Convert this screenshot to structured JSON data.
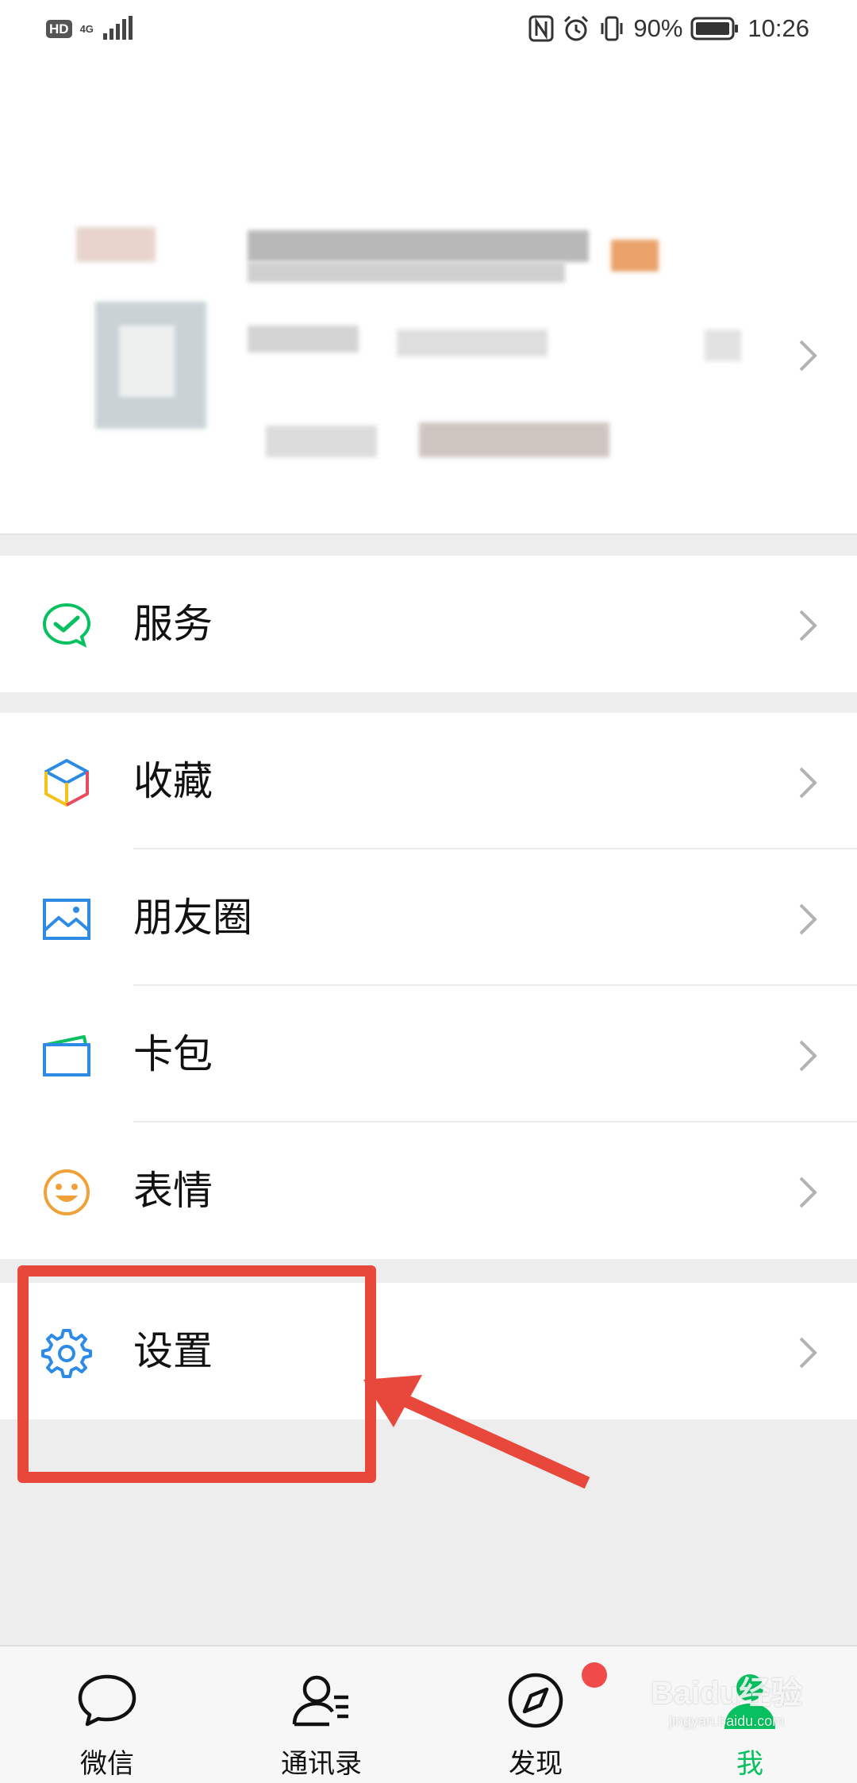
{
  "status_bar": {
    "hd": "HD",
    "network": "4G",
    "battery": "90%",
    "time": "10:26"
  },
  "menu": {
    "service": {
      "label": "服务",
      "icon": "wechat-pay-check-icon"
    },
    "favorites": {
      "label": "收藏",
      "icon": "cube-icon"
    },
    "moments": {
      "label": "朋友圈",
      "icon": "image-icon"
    },
    "cards": {
      "label": "卡包",
      "icon": "wallet-icon"
    },
    "stickers": {
      "label": "表情",
      "icon": "smiley-icon"
    },
    "settings": {
      "label": "设置",
      "icon": "gear-icon"
    }
  },
  "tabs": [
    {
      "label": "微信",
      "icon": "chat-bubble-icon",
      "active": false
    },
    {
      "label": "通讯录",
      "icon": "contacts-icon",
      "active": false
    },
    {
      "label": "发现",
      "icon": "compass-icon",
      "active": false,
      "badge": true
    },
    {
      "label": "我",
      "icon": "person-icon",
      "active": true
    }
  ],
  "watermark": {
    "brand": "Baidu经验",
    "url": "jingyan.baidu.com"
  },
  "colors": {
    "accent_green": "#07c160",
    "annotation_red": "#e8473c",
    "badge_red": "#f04a4a",
    "background": "#ededed"
  }
}
